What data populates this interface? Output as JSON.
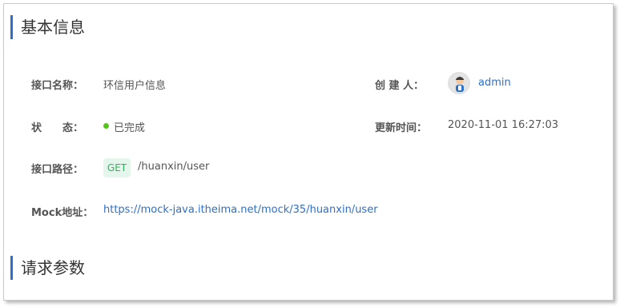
{
  "sections": {
    "basic_title": "基本信息",
    "params_title": "请求参数"
  },
  "fields": {
    "name_label": "接口名称：",
    "name_value": "环信用户信息",
    "status_label": "状　　态：",
    "status_value": "已完成",
    "status_color": "#52c41a",
    "path_label": "接口路径：",
    "method": "GET",
    "path_value": "/huanxin/user",
    "mock_label": "Mock地址：",
    "mock_url": "https://mock-java.itheima.net/mock/35/huanxin/user",
    "creator_label": "创 建 人：",
    "creator_name": "admin",
    "updated_label": "更新时间：",
    "updated_value": "2020-11-01 16:27:03"
  },
  "colors": {
    "accent": "#2e6fc7",
    "link": "#2e6fc7",
    "method_bg": "#e5f7ec",
    "method_text": "#2db35a"
  }
}
